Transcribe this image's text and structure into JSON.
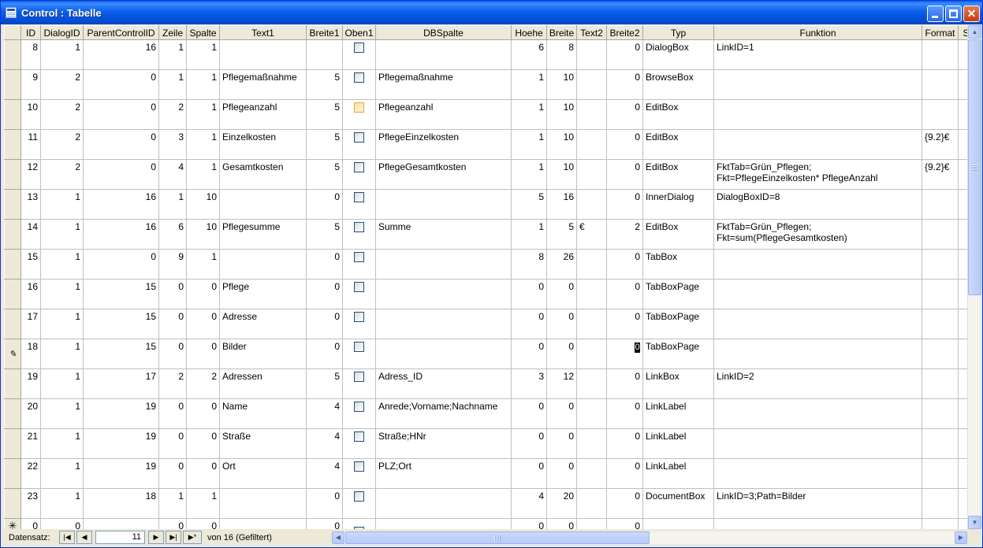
{
  "window": {
    "title": "Control : Tabelle"
  },
  "columns": [
    "ID",
    "DialogID",
    "ParentControlID",
    "Zeile",
    "Spalte",
    "Text1",
    "Breite1",
    "Oben1",
    "DBSpalte",
    "Hoehe",
    "Breite",
    "Text2",
    "Breite2",
    "Typ",
    "Funktion",
    "Format",
    "S"
  ],
  "rows": [
    {
      "ID": "8",
      "DialogID": "1",
      "ParentControlID": "16",
      "Zeile": "1",
      "Spalte": "1",
      "Text1": "",
      "Breite1": "",
      "Oben1": false,
      "DBSpalte": "",
      "Hoehe": "6",
      "Breite": "8",
      "Text2": "",
      "Breite2": "0",
      "Typ": "DialogBox",
      "Funktion": "LinkID=1",
      "Format": "",
      "marker": ""
    },
    {
      "ID": "9",
      "DialogID": "2",
      "ParentControlID": "0",
      "Zeile": "1",
      "Spalte": "1",
      "Text1": "Pflegemaßnahme",
      "Breite1": "5",
      "Oben1": false,
      "DBSpalte": "Pflegemaßnahme",
      "Hoehe": "1",
      "Breite": "10",
      "Text2": "",
      "Breite2": "0",
      "Typ": "BrowseBox",
      "Funktion": "",
      "Format": "",
      "marker": ""
    },
    {
      "ID": "10",
      "DialogID": "2",
      "ParentControlID": "0",
      "Zeile": "2",
      "Spalte": "1",
      "Text1": "Pflegeanzahl",
      "Breite1": "5",
      "Oben1": false,
      "hot": true,
      "DBSpalte": "Pflegeanzahl",
      "Hoehe": "1",
      "Breite": "10",
      "Text2": "",
      "Breite2": "0",
      "Typ": "EditBox",
      "Funktion": "",
      "Format": "",
      "marker": ""
    },
    {
      "ID": "11",
      "DialogID": "2",
      "ParentControlID": "0",
      "Zeile": "3",
      "Spalte": "1",
      "Text1": "Einzelkosten",
      "Breite1": "5",
      "Oben1": false,
      "DBSpalte": "PflegeEinzelkosten",
      "Hoehe": "1",
      "Breite": "10",
      "Text2": "",
      "Breite2": "0",
      "Typ": "EditBox",
      "Funktion": "",
      "Format": "{9.2}€",
      "marker": ""
    },
    {
      "ID": "12",
      "DialogID": "2",
      "ParentControlID": "0",
      "Zeile": "4",
      "Spalte": "1",
      "Text1": "Gesamtkosten",
      "Breite1": "5",
      "Oben1": false,
      "DBSpalte": "PflegeGesamtkosten",
      "Hoehe": "1",
      "Breite": "10",
      "Text2": "",
      "Breite2": "0",
      "Typ": "EditBox",
      "Funktion": "FktTab=Grün_Pflegen;\nFkt=PflegeEinzelkosten* PflegeAnzahl",
      "Format": "{9.2}€",
      "marker": ""
    },
    {
      "ID": "13",
      "DialogID": "1",
      "ParentControlID": "16",
      "Zeile": "1",
      "Spalte": "10",
      "Text1": "",
      "Breite1": "0",
      "Oben1": false,
      "DBSpalte": "",
      "Hoehe": "5",
      "Breite": "16",
      "Text2": "",
      "Breite2": "0",
      "Typ": "InnerDialog",
      "Funktion": "DialogBoxID=8",
      "Format": "",
      "marker": ""
    },
    {
      "ID": "14",
      "DialogID": "1",
      "ParentControlID": "16",
      "Zeile": "6",
      "Spalte": "10",
      "Text1": "Pflegesumme",
      "Breite1": "5",
      "Oben1": false,
      "DBSpalte": "Summe",
      "Hoehe": "1",
      "Breite": "5",
      "Text2": "€",
      "Breite2": "2",
      "Typ": "EditBox",
      "Funktion": "FktTab=Grün_Pflegen;\nFkt=sum(PflegeGesamtkosten)",
      "Format": "",
      "marker": ""
    },
    {
      "ID": "15",
      "DialogID": "1",
      "ParentControlID": "0",
      "Zeile": "9",
      "Spalte": "1",
      "Text1": "",
      "Breite1": "0",
      "Oben1": false,
      "DBSpalte": "",
      "Hoehe": "8",
      "Breite": "26",
      "Text2": "",
      "Breite2": "0",
      "Typ": "TabBox",
      "Funktion": "",
      "Format": "",
      "marker": ""
    },
    {
      "ID": "16",
      "DialogID": "1",
      "ParentControlID": "15",
      "Zeile": "0",
      "Spalte": "0",
      "Text1": "Pflege",
      "Breite1": "0",
      "Oben1": false,
      "DBSpalte": "",
      "Hoehe": "0",
      "Breite": "0",
      "Text2": "",
      "Breite2": "0",
      "Typ": "TabBoxPage",
      "Funktion": "",
      "Format": "",
      "marker": ""
    },
    {
      "ID": "17",
      "DialogID": "1",
      "ParentControlID": "15",
      "Zeile": "0",
      "Spalte": "0",
      "Text1": "Adresse",
      "Breite1": "0",
      "Oben1": false,
      "DBSpalte": "",
      "Hoehe": "0",
      "Breite": "0",
      "Text2": "",
      "Breite2": "0",
      "Typ": "TabBoxPage",
      "Funktion": "",
      "Format": "",
      "marker": ""
    },
    {
      "ID": "18",
      "DialogID": "1",
      "ParentControlID": "15",
      "Zeile": "0",
      "Spalte": "0",
      "Text1": "Bilder",
      "Breite1": "0",
      "Oben1": false,
      "DBSpalte": "",
      "Hoehe": "0",
      "Breite": "0",
      "Text2": "",
      "Breite2": "0",
      "Typ": "TabBoxPage",
      "Funktion": "",
      "Format": "",
      "marker": "edit",
      "editing": true
    },
    {
      "ID": "19",
      "DialogID": "1",
      "ParentControlID": "17",
      "Zeile": "2",
      "Spalte": "2",
      "Text1": "Adressen",
      "Breite1": "5",
      "Oben1": false,
      "DBSpalte": "Adress_ID",
      "Hoehe": "3",
      "Breite": "12",
      "Text2": "",
      "Breite2": "0",
      "Typ": "LinkBox",
      "Funktion": "LinkID=2",
      "Format": "",
      "marker": ""
    },
    {
      "ID": "20",
      "DialogID": "1",
      "ParentControlID": "19",
      "Zeile": "0",
      "Spalte": "0",
      "Text1": "Name",
      "Breite1": "4",
      "Oben1": false,
      "DBSpalte": "Anrede;Vorname;Nachname",
      "Hoehe": "0",
      "Breite": "0",
      "Text2": "",
      "Breite2": "0",
      "Typ": "LinkLabel",
      "Funktion": "",
      "Format": "",
      "marker": ""
    },
    {
      "ID": "21",
      "DialogID": "1",
      "ParentControlID": "19",
      "Zeile": "0",
      "Spalte": "0",
      "Text1": "Straße",
      "Breite1": "4",
      "Oben1": false,
      "DBSpalte": "Straße;HNr",
      "Hoehe": "0",
      "Breite": "0",
      "Text2": "",
      "Breite2": "0",
      "Typ": "LinkLabel",
      "Funktion": "",
      "Format": "",
      "marker": ""
    },
    {
      "ID": "22",
      "DialogID": "1",
      "ParentControlID": "19",
      "Zeile": "0",
      "Spalte": "0",
      "Text1": "Ort",
      "Breite1": "4",
      "Oben1": false,
      "DBSpalte": "PLZ;Ort",
      "Hoehe": "0",
      "Breite": "0",
      "Text2": "",
      "Breite2": "0",
      "Typ": "LinkLabel",
      "Funktion": "",
      "Format": "",
      "marker": ""
    },
    {
      "ID": "23",
      "DialogID": "1",
      "ParentControlID": "18",
      "Zeile": "1",
      "Spalte": "1",
      "Text1": "",
      "Breite1": "0",
      "Oben1": false,
      "DBSpalte": "",
      "Hoehe": "4",
      "Breite": "20",
      "Text2": "",
      "Breite2": "0",
      "Typ": "DocumentBox",
      "Funktion": "LinkID=3;Path=Bilder",
      "Format": "",
      "marker": ""
    },
    {
      "ID": "0",
      "DialogID": "0",
      "ParentControlID": "",
      "Zeile": "0",
      "Spalte": "0",
      "Text1": "",
      "Breite1": "0",
      "Oben1": false,
      "DBSpalte": "",
      "Hoehe": "0",
      "Breite": "0",
      "Text2": "",
      "Breite2": "0",
      "Typ": "",
      "Funktion": "",
      "Format": "",
      "marker": "new"
    }
  ],
  "statusbar": {
    "label": "Datensatz:",
    "current_record": "11",
    "count_text": "von  16 (Gefiltert)"
  },
  "icons": {
    "first": "first-record-icon",
    "prev": "previous-record-icon",
    "next": "next-record-icon",
    "last": "last-record-icon",
    "new": "new-record-icon"
  }
}
